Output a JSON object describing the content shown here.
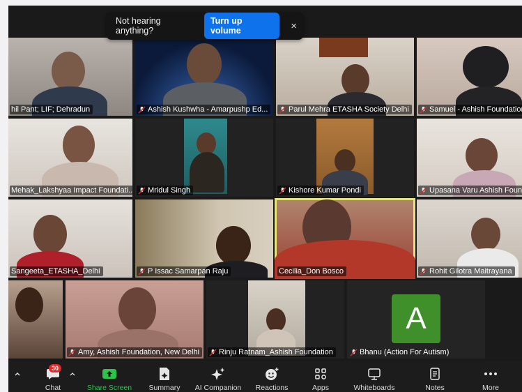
{
  "banner": {
    "message": "Not hearing anything?",
    "button": "Turn up volume",
    "close": "×"
  },
  "participants": [
    {
      "name": "hil  Pant; LIF; Dehradun",
      "muted": false
    },
    {
      "name": "Ashish Kushwha - Amarpushp Ed...",
      "muted": true
    },
    {
      "name": "Parul Mehra ETASHA Society Delhi",
      "muted": true
    },
    {
      "name": "Samuel - Ashish Foundation",
      "muted": true
    },
    {
      "name": "Mehak_Lakshyaa Impact Foundati...",
      "muted": false
    },
    {
      "name": "Mridul Singh",
      "muted": true
    },
    {
      "name": "Kishore Kumar Pondi",
      "muted": true
    },
    {
      "name": "Upasana Varu Ashish Foun",
      "muted": true
    },
    {
      "name": "Sangeeta_ETASHA_Delhi",
      "muted": false
    },
    {
      "name": "P Issac Samarpan Raju",
      "muted": true
    },
    {
      "name": "Cecilia_Don Bosco",
      "muted": false,
      "active": true
    },
    {
      "name": "Rohit Gilotra Maitrayana",
      "muted": true
    },
    {
      "name": "Amy, Ashish Foundation, New Delhi",
      "muted": true
    },
    {
      "name": "Rinju Ratnam_Ashish Foundation",
      "muted": true
    },
    {
      "name": "Bhanu (Action For Autism)",
      "muted": true,
      "avatar_letter": "A"
    }
  ],
  "toolbar": {
    "chat": "Chat",
    "chat_badge": "30",
    "share": "Share Screen",
    "summary": "Summary",
    "ai": "AI Companion",
    "reactions": "Reactions",
    "apps": "Apps",
    "whiteboards": "Whiteboards",
    "notes": "Notes",
    "more": "More"
  },
  "colors": {
    "accent": "#0e72ed",
    "share_green": "#2fc24a",
    "active_border": "#e8e57a",
    "avatar_bg": "#3f8f2a",
    "badge_red": "#e02828"
  }
}
